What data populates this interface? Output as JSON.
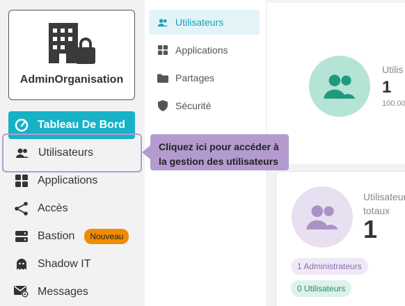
{
  "org": {
    "name": "AdminOrganisation",
    "icon": "building-lock-icon"
  },
  "sidebar": {
    "items": [
      {
        "label": "Tableau De Bord",
        "icon": "dashboard-gauge-icon",
        "active": true
      },
      {
        "label": "Utilisateurs",
        "icon": "users-icon",
        "highlighted": true
      },
      {
        "label": "Applications",
        "icon": "grid-icon"
      },
      {
        "label": "Accès",
        "icon": "share-icon"
      },
      {
        "label": "Bastion",
        "icon": "server-icon",
        "badge": "Nouveau"
      },
      {
        "label": "Shadow IT",
        "icon": "ghost-icon"
      },
      {
        "label": "Messages",
        "icon": "mail-at-icon"
      }
    ]
  },
  "tooltip": {
    "text1": "Cliquez ici pour accéder à",
    "text2": "la gestion des utilisateurs"
  },
  "submenu": {
    "items": [
      {
        "label": "Utilisateurs",
        "icon": "users-icon",
        "active": true
      },
      {
        "label": "Applications",
        "icon": "grid-icon"
      },
      {
        "label": "Partages",
        "icon": "folder-icon"
      },
      {
        "label": "Sécurité",
        "icon": "shield-icon"
      }
    ]
  },
  "stats": {
    "active_users": {
      "label": "Utilis",
      "value": "1",
      "sub": "100.00"
    },
    "total_users": {
      "label_line1": "Utilisateur",
      "label_line2": "totaux",
      "value": "1",
      "admins": "1 Administrateurs",
      "users": "0 Utilisateurs"
    }
  },
  "colors": {
    "accent": "#17b2c8",
    "tooltip": "#b39bcf",
    "badge": "#f08c00",
    "green_circle": "#b4e4d6",
    "purple_circle": "#e8e0f0"
  }
}
